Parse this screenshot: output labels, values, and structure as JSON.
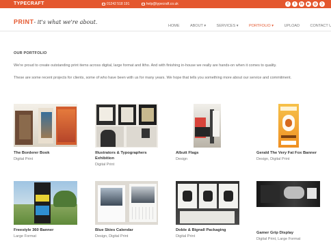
{
  "topbar": {
    "brand": "TYPECRAFT",
    "phone": "01242 518 191",
    "email": "help@typecraft.co.uk",
    "social_icons": [
      "facebook-icon",
      "twitter-icon",
      "linkedin-icon",
      "youtube-icon",
      "instagram-icon",
      "rss-icon"
    ],
    "color": "#e4572e"
  },
  "header": {
    "logo_mark": "PRINT",
    "logo_tagline": "- it's what we're about.",
    "nav": [
      {
        "label": "HOME"
      },
      {
        "label": "ABOUT ▾"
      },
      {
        "label": "SERVICES ▾"
      },
      {
        "label": "PORTFOLIO ▾"
      },
      {
        "label": "UPLOAD"
      },
      {
        "label": "CONTACT US"
      }
    ]
  },
  "main": {
    "section_title": "OUR PORTFOLIO",
    "intro": "We're proud to create outstanding print items across digital, large format and litho. And with finishing in-house we really are hands-on when it comes to quality.",
    "intro2": "These are some recent projects for clients, some of who have been with us for many years. We hope that tells you something more about our service and commitment.",
    "items": [
      {
        "title": "The Borderer Book",
        "category": "Digital Print"
      },
      {
        "title": "Illustrators & Typographers",
        "title2": "Exhibition",
        "category": "Digital Print"
      },
      {
        "title": "Albutt Flags",
        "category": "Design"
      },
      {
        "title": "Gerald The Very Fat Fox Banner",
        "category": "Design, Digital Print"
      },
      {
        "title": "Freestyle 360 Banner",
        "category": "Large Format"
      },
      {
        "title": "Blue Skies Calendar",
        "category": "Design, Digital Print"
      },
      {
        "title": "Doble & Bignall Packaging",
        "category": "Digital Print"
      },
      {
        "title": "Gamer Grip Display",
        "category": "Digital Print, Large Format"
      }
    ]
  }
}
